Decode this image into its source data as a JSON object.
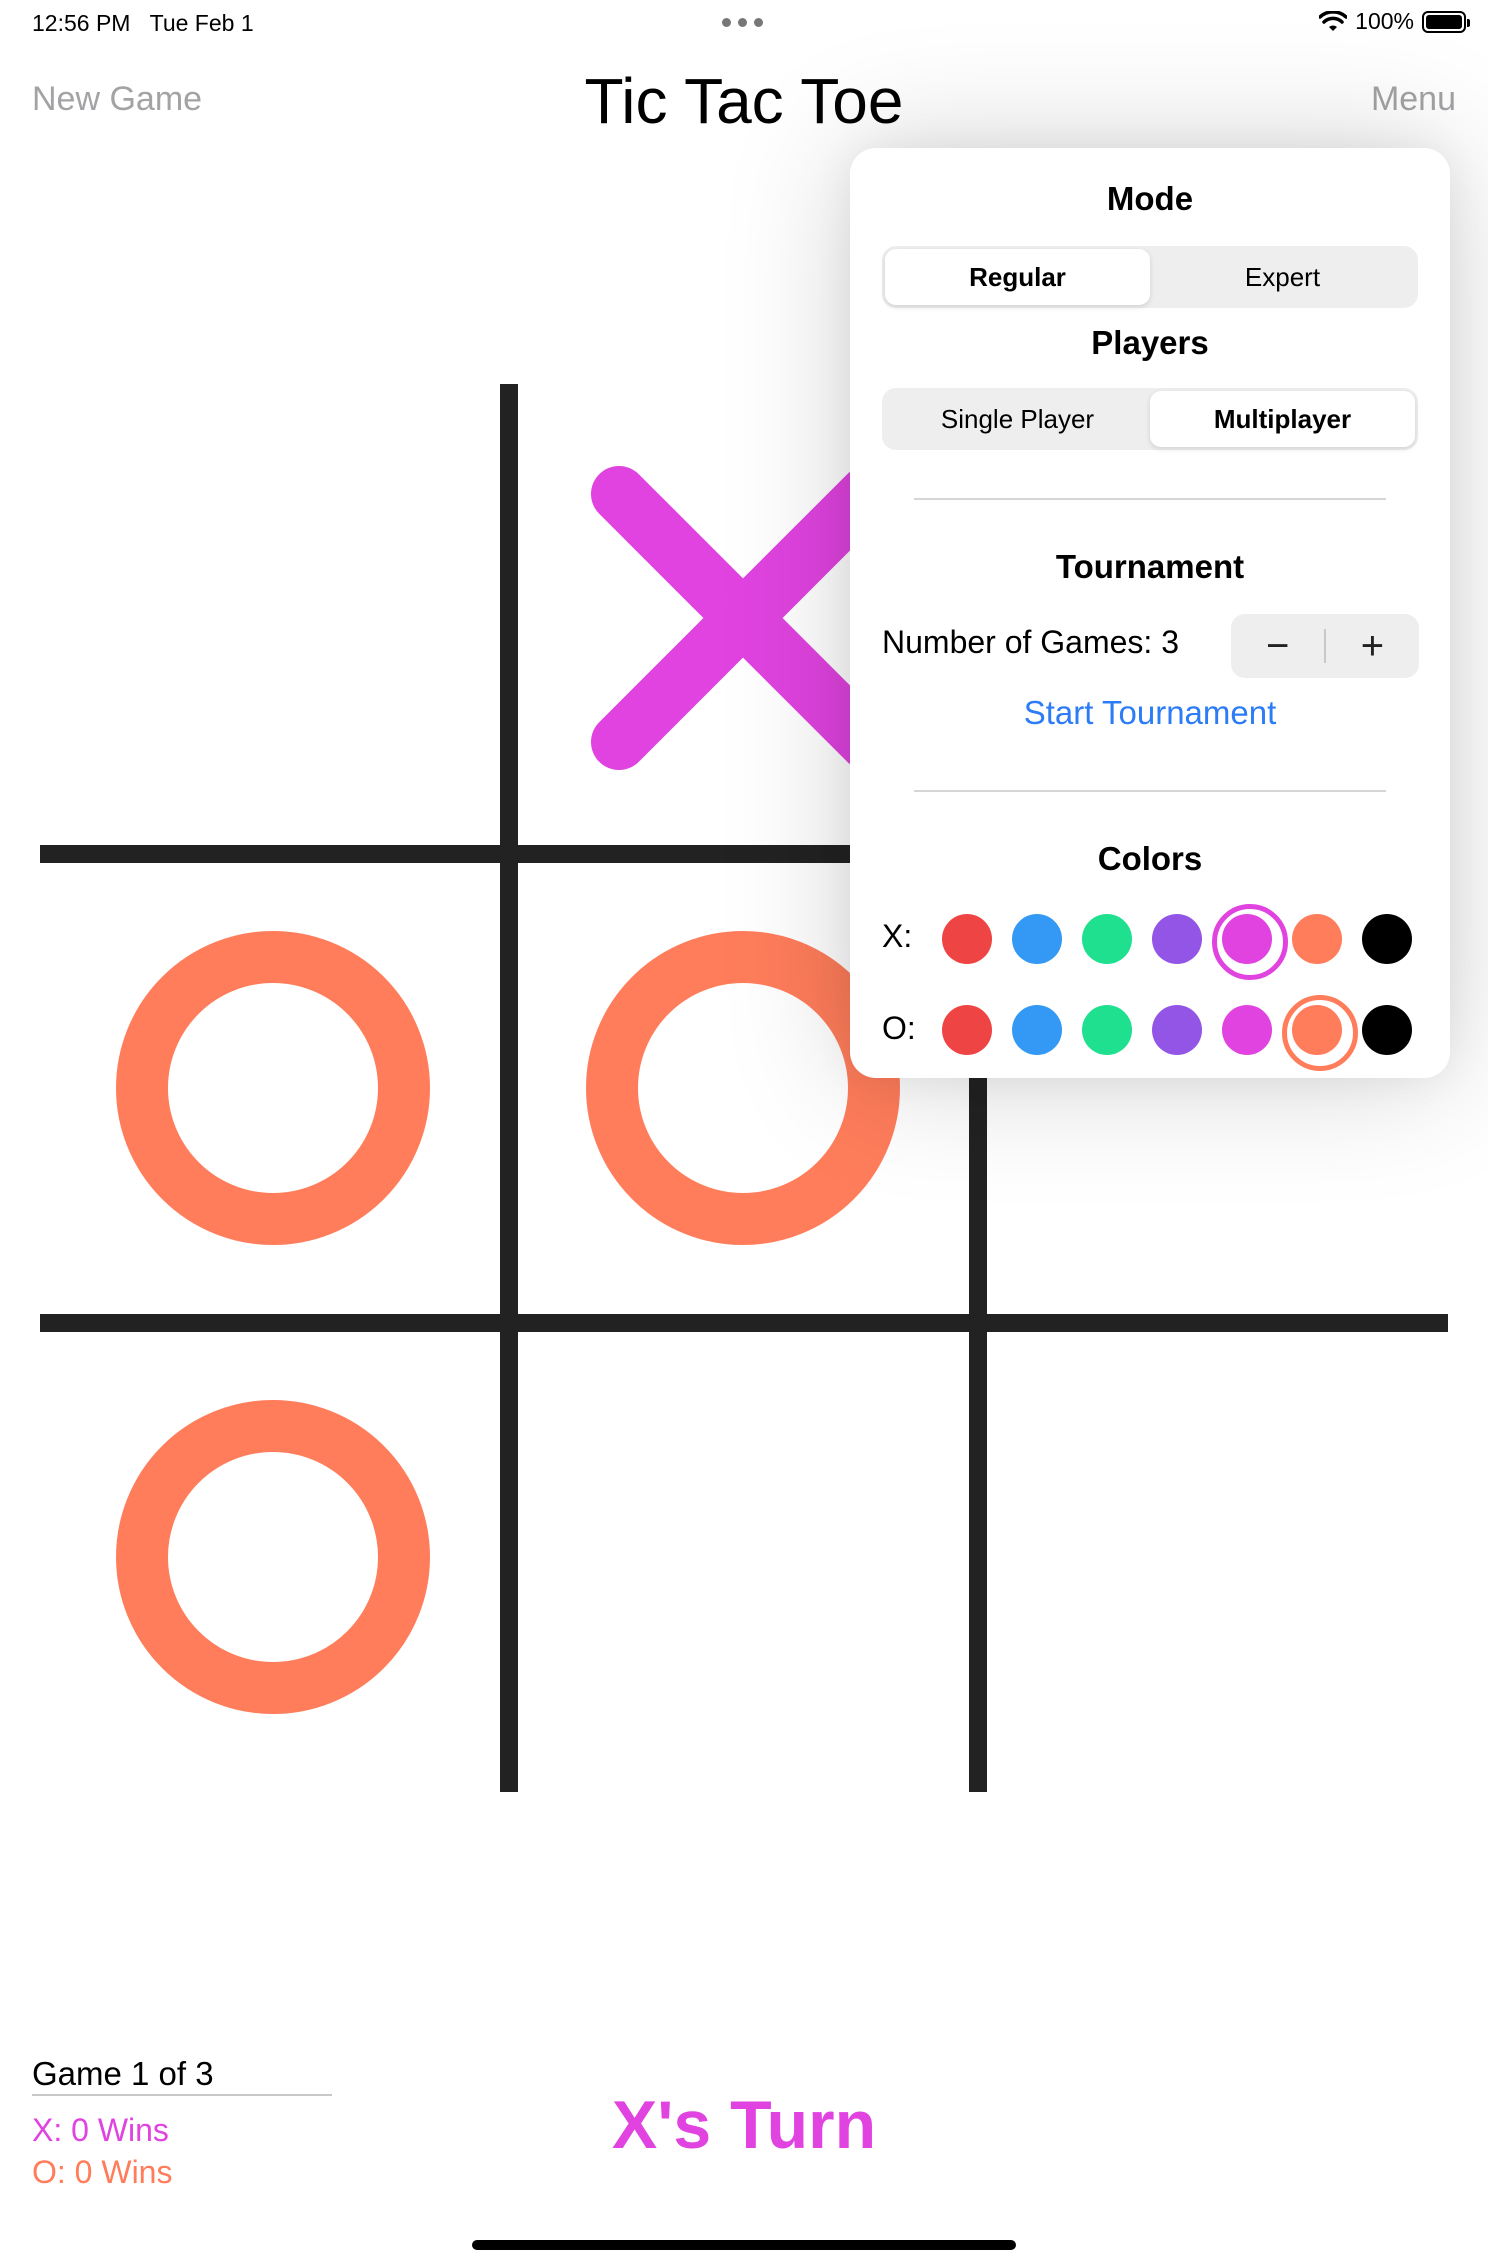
{
  "status_bar": {
    "time": "12:56 PM",
    "date": "Tue Feb 1",
    "battery": "100%"
  },
  "nav": {
    "new_game": "New Game",
    "title": "Tic Tac Toe",
    "menu": "Menu"
  },
  "board": {
    "cells": [
      "",
      "X",
      "",
      "O",
      "O",
      "",
      "O",
      "",
      ""
    ],
    "x_color": "#e043e0",
    "o_color": "#ff7d5b"
  },
  "menu_popover": {
    "mode": {
      "title": "Mode",
      "options": [
        "Regular",
        "Expert"
      ],
      "selected": "Regular"
    },
    "players": {
      "title": "Players",
      "options": [
        "Single Player",
        "Multiplayer"
      ],
      "selected": "Multiplayer"
    },
    "tournament": {
      "title": "Tournament",
      "games_label": "Number of Games: 3",
      "number_of_games": 3,
      "decrement": "−",
      "increment": "+",
      "start_label": "Start Tournament"
    },
    "colors": {
      "title": "Colors",
      "x_label": "X:",
      "o_label": "O:",
      "palette": [
        "#ef4444",
        "#3399f4",
        "#1ee08e",
        "#9355e6",
        "#e043e0",
        "#ff7d5b",
        "#000000"
      ],
      "x_selected": "#e043e0",
      "o_selected": "#ff7d5b"
    }
  },
  "footer": {
    "game_progress": "Game 1 of 3",
    "x_wins": "X: 0 Wins",
    "o_wins": "O: 0 Wins",
    "turn": "X's Turn"
  }
}
